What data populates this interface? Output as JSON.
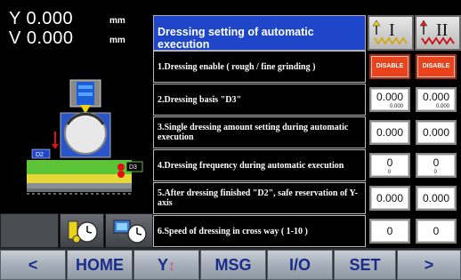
{
  "readout": {
    "y_label": "Y 0.000",
    "v_label": "V 0.000",
    "unit_y": "mm",
    "unit_v": "mm"
  },
  "machine_tags": {
    "left_tag": "D2",
    "right_tag": "D3"
  },
  "header": {
    "title": "Dressing setting of automatic execution",
    "mode1_roman": "I",
    "mode2_roman": "II"
  },
  "rows": [
    {
      "label": "1.Dressing enable ( rough / fine grinding )",
      "v1": "DISABLE",
      "v2": "DISABLE"
    },
    {
      "label": "2.Dressing basis \"D3\"",
      "v1": "0.000",
      "v1_sub": "0.000",
      "v2": "0.000",
      "v2_sub": "0.000"
    },
    {
      "label": "3.Single dressing amount setting during automatic execution",
      "v1": "0.000",
      "v2": "0.000"
    },
    {
      "label": "4.Dressing frequency during automatic execution",
      "v1": "0",
      "v1_sub": "0",
      "v2": "0",
      "v2_sub": "0"
    },
    {
      "label": "5.After dressing finished \"D2\",  safe reservation of Y-axis",
      "v1": "0.000",
      "v2": "0.000"
    },
    {
      "label": "6.Speed of dressing in cross way ( 1-10 )",
      "v1": "0",
      "v2": "0"
    }
  ],
  "nav": {
    "prev": "<",
    "home": "HOME",
    "y_axis": "Y",
    "y_axis_icon": "↕",
    "msg": "MSG",
    "io": "I/O",
    "set": "SET",
    "next": ">"
  },
  "colors": {
    "header_blue": "#1f46c8",
    "disable_red": "#e8431c",
    "nav_text": "#1b2d8c",
    "axis_arrow_pink": "#d0488a"
  }
}
